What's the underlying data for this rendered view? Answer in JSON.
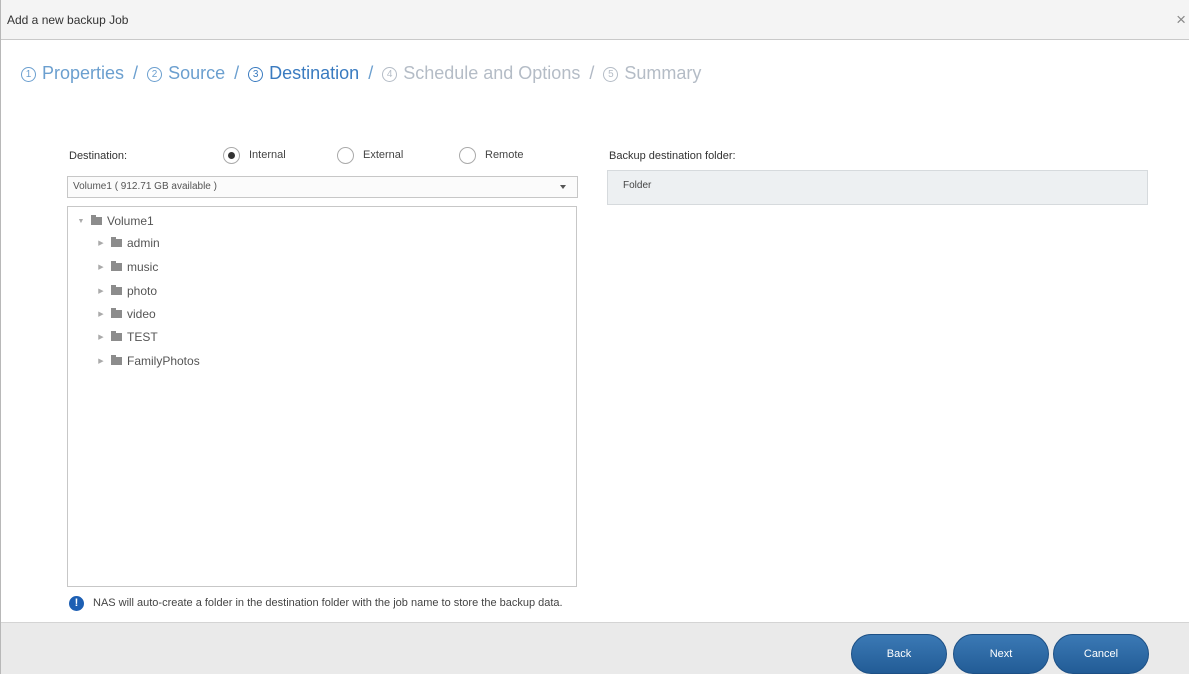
{
  "dialog": {
    "title": "Add a new backup Job",
    "close_glyph": "×"
  },
  "steps": [
    {
      "number": "1",
      "label": "Properties",
      "state": "done"
    },
    {
      "number": "2",
      "label": "Source",
      "state": "done"
    },
    {
      "number": "3",
      "label": "Destination",
      "state": "active"
    },
    {
      "number": "4",
      "label": "Schedule and Options",
      "state": "pending"
    },
    {
      "number": "5",
      "label": "Summary",
      "state": "pending"
    }
  ],
  "step_separator": "/",
  "destination": {
    "label": "Destination:",
    "options": [
      {
        "label": "Internal",
        "checked": true
      },
      {
        "label": "External",
        "checked": false
      },
      {
        "label": "Remote",
        "checked": false
      }
    ],
    "volume_selected": "Volume1 ( 912.71 GB available )"
  },
  "tree": {
    "root": {
      "label": "Volume1",
      "icon": "folder-icon",
      "expanded": true
    },
    "children": [
      {
        "label": "admin",
        "icon": "folder-icon"
      },
      {
        "label": "music",
        "icon": "folder-icon"
      },
      {
        "label": "photo",
        "icon": "folder-icon"
      },
      {
        "label": "video",
        "icon": "folder-icon"
      },
      {
        "label": "TEST",
        "icon": "folder-icon"
      },
      {
        "label": "FamilyPhotos",
        "icon": "folder-icon"
      }
    ]
  },
  "backup_folder": {
    "label": "Backup destination folder:",
    "value": "Folder"
  },
  "info": {
    "icon": "info-icon",
    "glyph": "!",
    "text": "NAS will auto-create a folder in the destination folder with the job name to store the backup data."
  },
  "buttons": {
    "back": "Back",
    "next": "Next",
    "cancel": "Cancel"
  },
  "colors": {
    "accent": "#3a7bc0",
    "step_done": "#6b9fcf",
    "step_pending": "#b4bcc6",
    "button": "#225c96",
    "info_icon": "#1d5fb3"
  }
}
